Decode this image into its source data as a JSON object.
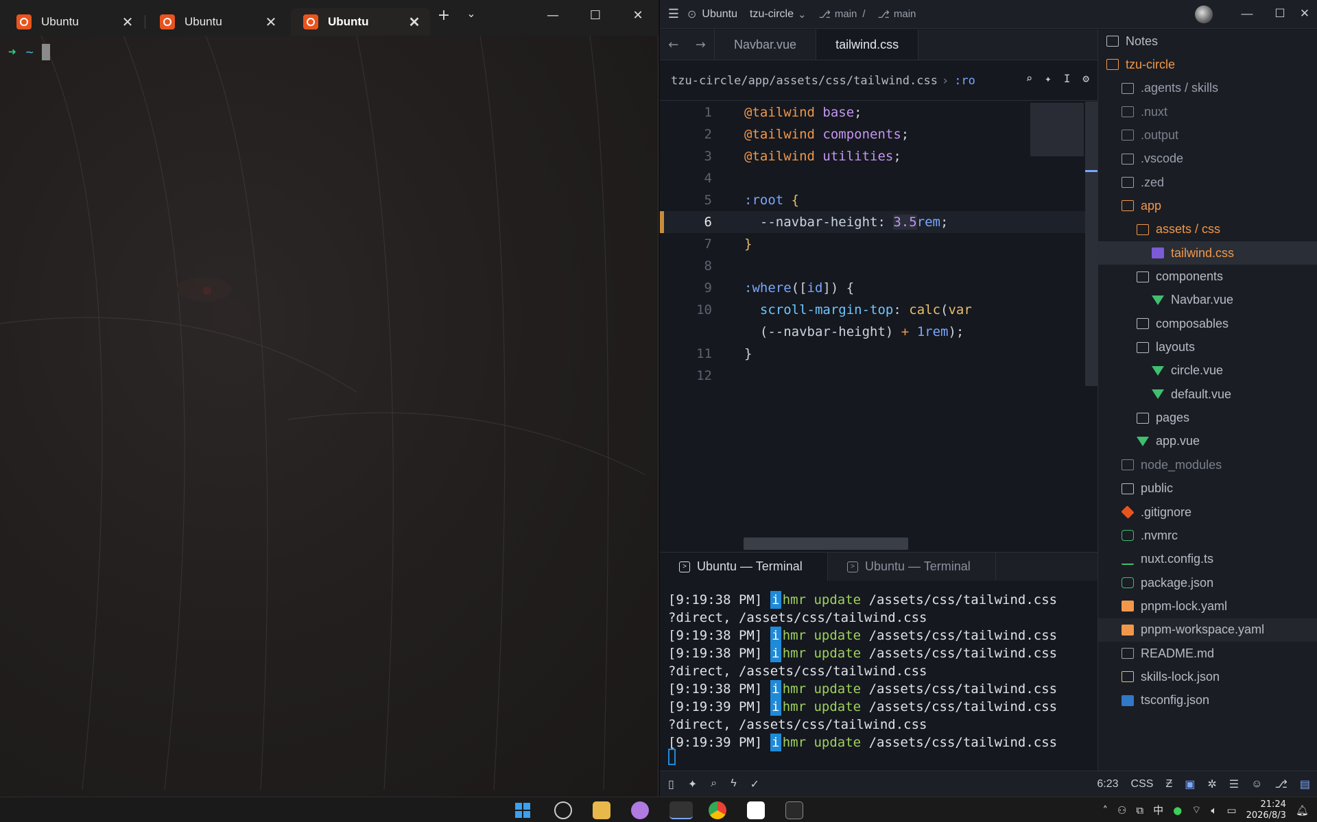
{
  "terminal": {
    "tabs": [
      {
        "label": "Ubuntu",
        "active": false
      },
      {
        "label": "Ubuntu",
        "active": false
      },
      {
        "label": "Ubuntu",
        "active": true
      }
    ],
    "prompt_arrow": "➜",
    "prompt_dir": "~"
  },
  "editor": {
    "titlebar": {
      "host": "Ubuntu",
      "project": "tzu-circle",
      "branch1": "main",
      "branch2": "main"
    },
    "tabs": [
      {
        "label": "Navbar.vue",
        "active": false
      },
      {
        "label": "tailwind.css",
        "active": true
      }
    ],
    "breadcrumb": {
      "path": "tzu-circle/app/assets/css/tailwind.css",
      "symbol": ":ro"
    },
    "code_lines": [
      {
        "n": "1",
        "text": "@tailwind base;"
      },
      {
        "n": "2",
        "text": "@tailwind components;"
      },
      {
        "n": "3",
        "text": "@tailwind utilities;"
      },
      {
        "n": "4",
        "text": ""
      },
      {
        "n": "5",
        "text": ":root {"
      },
      {
        "n": "6",
        "text": "  --navbar-height: 3.5rem;"
      },
      {
        "n": "7",
        "text": "}"
      },
      {
        "n": "8",
        "text": ""
      },
      {
        "n": "9",
        "text": ":where([id]) {"
      },
      {
        "n": "10",
        "text": "  scroll-margin-top: calc(var"
      },
      {
        "n": "",
        "text": "  (--navbar-height) + 1rem);"
      },
      {
        "n": "11",
        "text": "}"
      },
      {
        "n": "12",
        "text": ""
      }
    ],
    "current_line": "6",
    "terminal_tabs": [
      {
        "label": "Ubuntu — Terminal",
        "active": true
      },
      {
        "label": "Ubuntu — Terminal",
        "active": false
      }
    ],
    "terminal_lines": [
      {
        "time": "[9:19:38 PM]",
        "msg": "hmr update",
        "path": "/assets/css/tailwind.css"
      },
      {
        "cont": "?direct, /assets/css/tailwind.css"
      },
      {
        "time": "[9:19:38 PM]",
        "msg": "hmr update",
        "path": "/assets/css/tailwind.css"
      },
      {
        "time": "[9:19:38 PM]",
        "msg": "hmr update",
        "path": "/assets/css/tailwind.css"
      },
      {
        "cont": "?direct, /assets/css/tailwind.css"
      },
      {
        "time": "[9:19:38 PM]",
        "msg": "hmr update",
        "path": "/assets/css/tailwind.css"
      },
      {
        "time": "[9:19:39 PM]",
        "msg": "hmr update",
        "path": "/assets/css/tailwind.css"
      },
      {
        "cont": "?direct, /assets/css/tailwind.css"
      },
      {
        "time": "[9:19:39 PM]",
        "msg": "hmr update",
        "path": "/assets/css/tailwind.css"
      }
    ],
    "status": {
      "cursor_pos": "6:23",
      "language": "CSS"
    }
  },
  "project_panel": {
    "items": [
      {
        "label": "Notes",
        "depth": 0,
        "kind": "folder",
        "color": "#b8bcc6"
      },
      {
        "label": "tzu-circle",
        "depth": 0,
        "kind": "folder-open",
        "color": "#f2984a"
      },
      {
        "label": ".agents / skills",
        "depth": 1,
        "kind": "folder",
        "color": "#9aa1ad"
      },
      {
        "label": ".nuxt",
        "depth": 1,
        "kind": "folder",
        "color": "#7a808c"
      },
      {
        "label": ".output",
        "depth": 1,
        "kind": "folder",
        "color": "#7a808c"
      },
      {
        "label": ".vscode",
        "depth": 1,
        "kind": "folder",
        "color": "#9aa1ad"
      },
      {
        "label": ".zed",
        "depth": 1,
        "kind": "folder",
        "color": "#9aa1ad"
      },
      {
        "label": "app",
        "depth": 1,
        "kind": "folder-open",
        "color": "#f2984a"
      },
      {
        "label": "assets / css",
        "depth": 2,
        "kind": "folder-open",
        "color": "#f2984a"
      },
      {
        "label": "tailwind.css",
        "depth": 3,
        "kind": "css",
        "color": "#f2984a"
      },
      {
        "label": "components",
        "depth": 2,
        "kind": "folder",
        "color": "#b8bcc6"
      },
      {
        "label": "Navbar.vue",
        "depth": 3,
        "kind": "vue",
        "color": "#b8bcc6"
      },
      {
        "label": "composables",
        "depth": 2,
        "kind": "folder",
        "color": "#b8bcc6"
      },
      {
        "label": "layouts",
        "depth": 2,
        "kind": "folder",
        "color": "#b8bcc6"
      },
      {
        "label": "circle.vue",
        "depth": 3,
        "kind": "vue",
        "color": "#b8bcc6"
      },
      {
        "label": "default.vue",
        "depth": 3,
        "kind": "vue",
        "color": "#b8bcc6"
      },
      {
        "label": "pages",
        "depth": 2,
        "kind": "folder",
        "color": "#b8bcc6"
      },
      {
        "label": "app.vue",
        "depth": 2,
        "kind": "vue",
        "color": "#b8bcc6"
      },
      {
        "label": "node_modules",
        "depth": 1,
        "kind": "folder",
        "color": "#7a808c"
      },
      {
        "label": "public",
        "depth": 1,
        "kind": "folder",
        "color": "#b8bcc6"
      },
      {
        "label": ".gitignore",
        "depth": 1,
        "kind": "git",
        "color": "#b8bcc6"
      },
      {
        "label": ".nvmrc",
        "depth": 1,
        "kind": "node",
        "color": "#b8bcc6"
      },
      {
        "label": "nuxt.config.ts",
        "depth": 1,
        "kind": "nuxt",
        "color": "#b8bcc6"
      },
      {
        "label": "package.json",
        "depth": 1,
        "kind": "node",
        "color": "#b8bcc6"
      },
      {
        "label": "pnpm-lock.yaml",
        "depth": 1,
        "kind": "pnpm",
        "color": "#b8bcc6"
      },
      {
        "label": "pnpm-workspace.yaml",
        "depth": 1,
        "kind": "pnpm",
        "color": "#b8bcc6"
      },
      {
        "label": "README.md",
        "depth": 1,
        "kind": "md",
        "color": "#b8bcc6"
      },
      {
        "label": "skills-lock.json",
        "depth": 1,
        "kind": "json",
        "color": "#b8bcc6"
      },
      {
        "label": "tsconfig.json",
        "depth": 1,
        "kind": "ts",
        "color": "#b8bcc6"
      }
    ],
    "selected": "tailwind.css",
    "hovered": "pnpm-workspace.yaml"
  },
  "taskbar": {
    "ime": "中",
    "clock_time": "21:24",
    "clock_date": "2026/8/3"
  },
  "colors": {
    "accent": "#f2984a",
    "info": "#1f8ad8",
    "prompt_green": "#2fcf7f"
  }
}
